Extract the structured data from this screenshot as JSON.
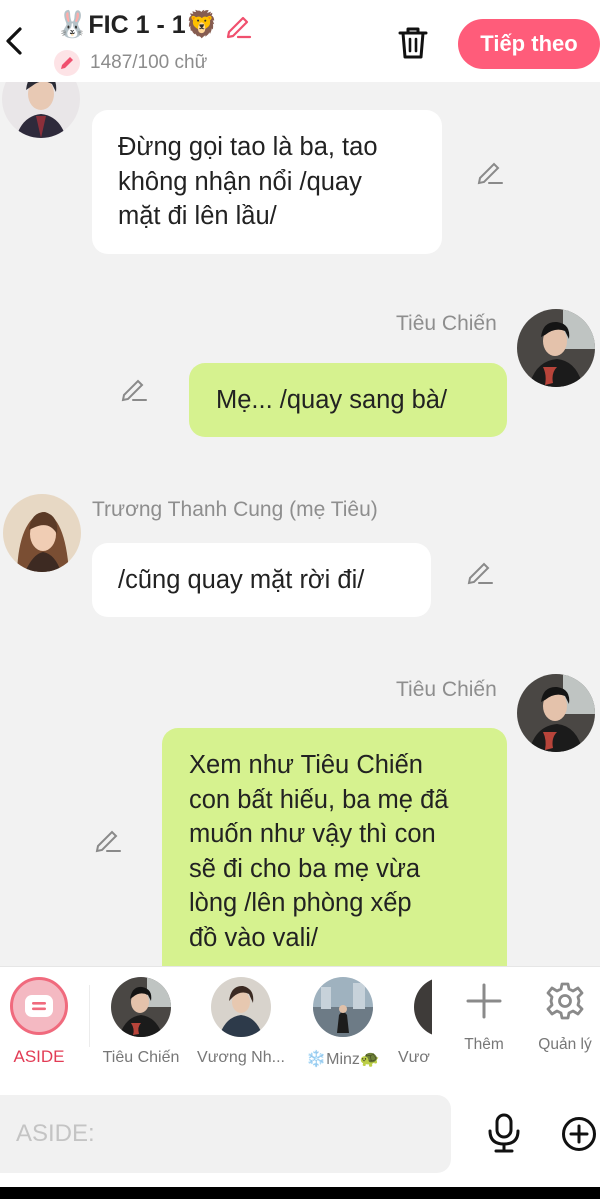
{
  "header": {
    "title_prefix_emoji": "🐰",
    "title": "FIC 1 - 1",
    "title_suffix_emoji": "🦁",
    "word_count": "1487/100 chữ",
    "next_label": "Tiếp theo",
    "accent_color": "#ff5c7a"
  },
  "messages": [
    {
      "side": "left",
      "speaker": "",
      "text_lines": [
        "Đừng gọi tao là ba, tao",
        "không nhận nổi /quay",
        "mặt đi lên lầu/"
      ]
    },
    {
      "side": "right",
      "speaker": "Tiêu Chiến",
      "text_lines": [
        "Mẹ... /quay sang bà/"
      ]
    },
    {
      "side": "left",
      "speaker": "Trương Thanh Cung (mẹ Tiêu)",
      "text_lines": [
        "/cũng quay mặt rời đi/"
      ]
    },
    {
      "side": "right",
      "speaker": "Tiêu Chiến",
      "text_lines": [
        "Xem như Tiêu Chiến",
        "con bất hiếu, ba mẹ đã",
        "muốn như vậy thì con",
        "sẽ đi cho ba mẹ vừa",
        "lòng /lên phòng xếp",
        "đồ vào vali/"
      ]
    }
  ],
  "character_bar": {
    "aside_label": "ASIDE",
    "characters": [
      {
        "label": "Tiêu Chiến"
      },
      {
        "label": "Vương Nh..."
      },
      {
        "label": "❄️Minz🐢"
      },
      {
        "label": "Vươ"
      }
    ],
    "add_label": "Thêm",
    "manage_label": "Quản lý"
  },
  "input": {
    "placeholder": "ASIDE:"
  },
  "colors": {
    "bubble_left": "#ffffff",
    "bubble_right": "#d6f28f",
    "background": "#f2f2f2"
  }
}
